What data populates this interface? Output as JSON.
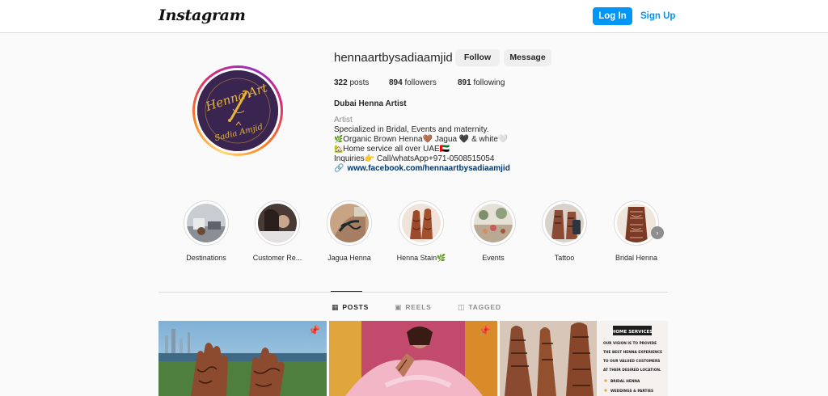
{
  "header": {
    "logo": "Instagram",
    "login_label": "Log In",
    "signup_label": "Sign Up"
  },
  "profile": {
    "username": "hennaartbysadiaamjid",
    "follow_label": "Follow",
    "message_label": "Message",
    "posts_count": "322",
    "posts_label": "posts",
    "followers_count": "894",
    "followers_label": "followers",
    "following_count": "891",
    "following_label": "following",
    "display_name": "Dubai Henna Artist",
    "category": "Artist",
    "bio_line1": "Specialized in Bridal, Events and maternity.",
    "bio_line2": "Organic Brown Henna🤎 Jagua 🖤 & white🤍",
    "bio_line3": "Home service all over UAE🇦🇪",
    "bio_line4": "Inquiries👉 Call/whatsApp+971-0508515054",
    "link": "www.facebook.com/hennaartbysadiaamjid",
    "avatar_text_top": "Henna Art",
    "avatar_text_bottom": "Sadia Amjid"
  },
  "highlights": [
    {
      "label": "Destinations"
    },
    {
      "label": "Customer Re..."
    },
    {
      "label": "Jagua Henna"
    },
    {
      "label": "Henna Stain🌿"
    },
    {
      "label": "Events"
    },
    {
      "label": "Tattoo"
    },
    {
      "label": "Bridal Henna"
    }
  ],
  "tabs": {
    "posts": "POSTS",
    "reels": "REELS",
    "tagged": "TAGGED"
  },
  "posts": {
    "third_overlay": {
      "title": "HOME SERVICES",
      "line1": "OUR VISION IS TO PROVIDE",
      "line2": "THE BEST HENNA EXPERIENCE",
      "line3": "TO OUR VALUED CUSTOMERS",
      "line4": "AT THEIR DESIRED LOCATION.",
      "bullet1": "BRIDAL HENNA",
      "bullet2": "WEDDINGS & PARTIES"
    }
  },
  "colors": {
    "accent": "#0095f6",
    "link": "#00376b",
    "muted": "#8e8e8e",
    "avatar_bg": "#3a2550",
    "avatar_text": "#e7b43a"
  },
  "icons": [
    "pin-icon",
    "link-icon",
    "grid-icon",
    "reels-icon",
    "tagged-icon",
    "chevron-right-icon"
  ]
}
